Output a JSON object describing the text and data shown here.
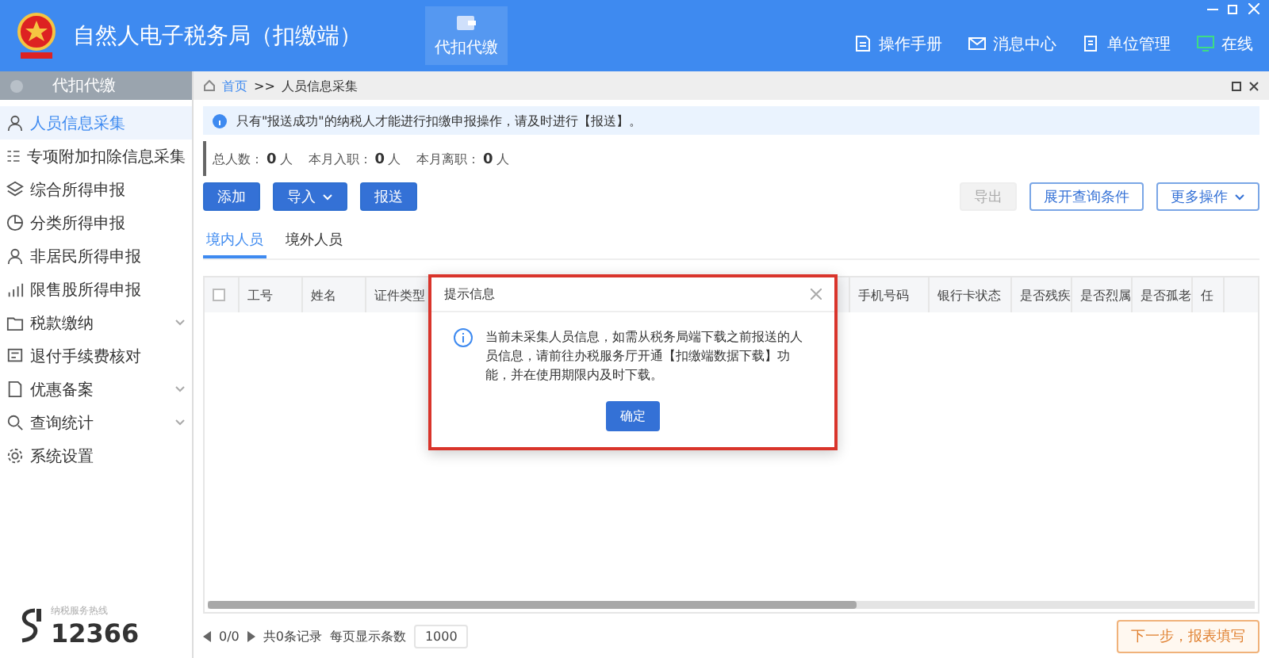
{
  "header": {
    "title": "自然人电子税务局（扣缴端）",
    "nav": [
      {
        "label": "代扣代缴",
        "selected": true
      }
    ],
    "links": [
      {
        "label": "操作手册",
        "kind": "doc"
      },
      {
        "label": "消息中心",
        "kind": "mail"
      },
      {
        "label": "单位管理",
        "kind": "unit"
      },
      {
        "label": "在线",
        "kind": "online"
      }
    ]
  },
  "sidebar": {
    "title": "代扣代缴",
    "items": [
      {
        "label": "人员信息采集",
        "selected": true,
        "expandable": false
      },
      {
        "label": "专项附加扣除信息采集",
        "selected": false,
        "expandable": false
      },
      {
        "label": "综合所得申报",
        "selected": false,
        "expandable": false
      },
      {
        "label": "分类所得申报",
        "selected": false,
        "expandable": false
      },
      {
        "label": "非居民所得申报",
        "selected": false,
        "expandable": false
      },
      {
        "label": "限售股所得申报",
        "selected": false,
        "expandable": false
      },
      {
        "label": "税款缴纳",
        "selected": false,
        "expandable": true
      },
      {
        "label": "退付手续费核对",
        "selected": false,
        "expandable": false
      },
      {
        "label": "优惠备案",
        "selected": false,
        "expandable": true
      },
      {
        "label": "查询统计",
        "selected": false,
        "expandable": true
      },
      {
        "label": "系统设置",
        "selected": false,
        "expandable": false
      }
    ],
    "hotline_label": "纳税服务热线",
    "hotline": "12366"
  },
  "breadcrumb": [
    "首页",
    ">>",
    "人员信息采集"
  ],
  "notice": "只有\"报送成功\"的纳税人才能进行扣缴申报操作，请及时进行【报送】。",
  "stats": [
    {
      "label": "总人数：",
      "value": "0",
      "unit": "人"
    },
    {
      "label": "本月入职：",
      "value": "0",
      "unit": "人"
    },
    {
      "label": "本月离职：",
      "value": "0",
      "unit": "人"
    }
  ],
  "actions_left": [
    {
      "label": "添加",
      "dropdown": false
    },
    {
      "label": "导入",
      "dropdown": true
    },
    {
      "label": "报送",
      "dropdown": false
    }
  ],
  "actions_right": [
    {
      "label": "导出",
      "disabled": true,
      "dropdown": false
    },
    {
      "label": "展开查询条件",
      "disabled": false,
      "dropdown": false
    },
    {
      "label": "更多操作",
      "disabled": false,
      "dropdown": true
    }
  ],
  "tabs": [
    {
      "label": "境内人员",
      "selected": true
    },
    {
      "label": "境外人员",
      "selected": false
    }
  ],
  "table": {
    "select_all_checked": false,
    "columns": [
      "工号",
      "姓名",
      "证件类型",
      "",
      "",
      "手机号码",
      "银行卡状态",
      "是否残疾",
      "是否烈属",
      "是否孤老",
      "任"
    ]
  },
  "pagination": {
    "pages": "0/0",
    "total": "共0条记录",
    "page_size_label": "每页显示条数",
    "page_size": "1000"
  },
  "next_button": "下一步，报表填写",
  "dialog": {
    "title": "提示信息",
    "message": "当前未采集人员信息，如需从税务局端下载之前报送的人员信息，请前往办税服务厅开通【扣缴端数据下载】功能，并在使用期限内及时下载。",
    "button": "确定"
  }
}
